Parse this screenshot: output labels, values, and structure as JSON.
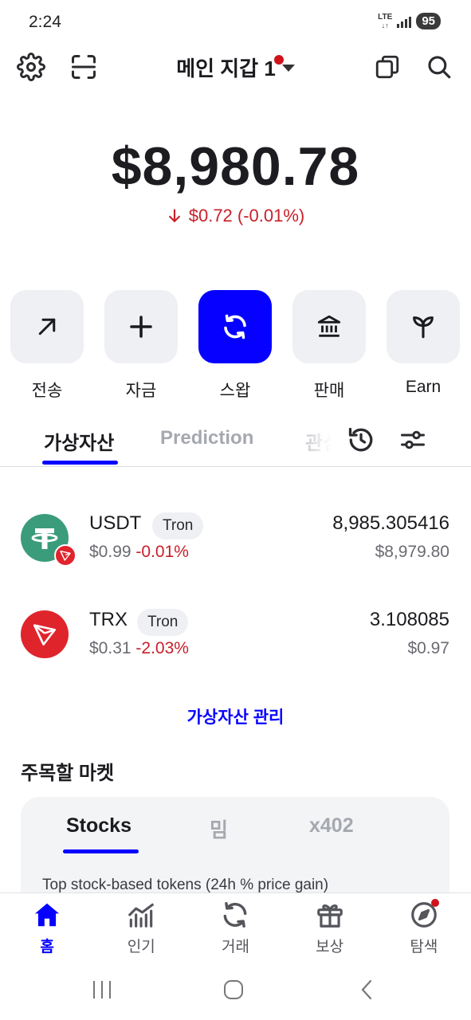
{
  "status_bar": {
    "time": "2:24",
    "network": "LTE",
    "battery": "95"
  },
  "header": {
    "wallet_name": "메인 지갑 1",
    "icons": [
      "gear-icon",
      "scan-icon",
      "copy-icon",
      "search-icon"
    ],
    "notification_color": "#d0121b"
  },
  "balance": {
    "total": "$8,980.78",
    "change": "$0.72 (-0.01%)",
    "direction": "down"
  },
  "actions": [
    {
      "label": "전송",
      "icon": "arrow-up-right-icon"
    },
    {
      "label": "자금",
      "icon": "plus-icon"
    },
    {
      "label": "스왑",
      "icon": "swap-icon"
    },
    {
      "label": "판매",
      "icon": "bank-icon"
    },
    {
      "label": "Earn",
      "icon": "sprout-icon"
    }
  ],
  "tabs": [
    {
      "label": "가상자산",
      "active": true
    },
    {
      "label": "Prediction",
      "active": false
    },
    {
      "label": "관심",
      "active": false
    }
  ],
  "tokens": [
    {
      "symbol": "USDT",
      "network": "Tron",
      "price": "$0.99",
      "change": "-0.01%",
      "amount": "8,985.305416",
      "value": "$8,979.80",
      "color": "#3a9c7b"
    },
    {
      "symbol": "TRX",
      "network": "Tron",
      "price": "$0.31",
      "change": "-2.03%",
      "amount": "3.108085",
      "value": "$0.97",
      "color": "#e0242c"
    }
  ],
  "manage_link": "가상자산 관리",
  "markets": {
    "title": "주목할 마켓",
    "tabs": [
      {
        "label": "Stocks",
        "active": true
      },
      {
        "label": "밈",
        "active": false
      },
      {
        "label": "x402",
        "active": false
      }
    ],
    "subtitle": "Top stock-based tokens (24h % price gain)"
  },
  "bottom_nav": [
    {
      "label": "홈",
      "icon": "home-icon",
      "active": true
    },
    {
      "label": "인기",
      "icon": "trending-icon",
      "active": false
    },
    {
      "label": "거래",
      "icon": "swap-icon",
      "active": false
    },
    {
      "label": "보상",
      "icon": "gift-icon",
      "active": false
    },
    {
      "label": "탐색",
      "icon": "compass-icon",
      "active": false
    }
  ],
  "colors": {
    "accent": "#0500ff",
    "negative": "#c8202a"
  }
}
